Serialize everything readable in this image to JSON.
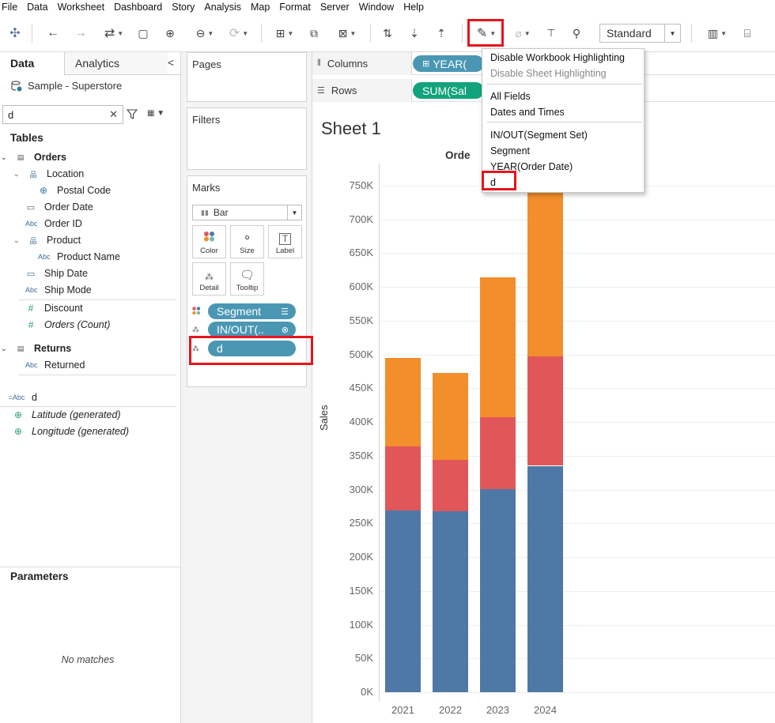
{
  "menu": [
    "File",
    "Data",
    "Worksheet",
    "Dashboard",
    "Story",
    "Analysis",
    "Map",
    "Format",
    "Server",
    "Window",
    "Help"
  ],
  "toolbar": {
    "view_mode": "Standard",
    "icons": [
      "tableau-logo-icon",
      "undo-icon",
      "redo-icon",
      "swap-icon",
      "save-icon",
      "new-datasource-icon",
      "pause-auto-update-icon",
      "refresh-icon",
      "new-worksheet-icon",
      "duplicate-sheet-icon",
      "clear-sheet-icon",
      "swap-rows-columns-icon",
      "sort-ascending-icon",
      "sort-descending-icon",
      "highlight-icon",
      "group-members-icon",
      "show-labels-icon",
      "fix-axes-icon",
      "show-me-icon",
      "presentation-icon"
    ]
  },
  "left_pane": {
    "tabs": [
      "Data",
      "Analytics"
    ],
    "data_source": "Sample - Superstore",
    "search_value": "d",
    "tables_heading": "Tables",
    "fields": [
      {
        "label": "Orders",
        "icon": "table-icon"
      },
      {
        "label": "Location",
        "icon": "hierarchy-icon"
      },
      {
        "label": "Postal Code",
        "icon": "globe-icon"
      },
      {
        "label": "Order Date",
        "icon": "calendar-icon"
      },
      {
        "label": "Order ID",
        "icon": "abc-icon"
      },
      {
        "label": "Product",
        "icon": "hierarchy-icon"
      },
      {
        "label": "Product Name",
        "icon": "abc-icon"
      },
      {
        "label": "Ship Date",
        "icon": "calendar-icon"
      },
      {
        "label": "Ship Mode",
        "icon": "abc-icon"
      },
      {
        "label": "Discount",
        "icon": "number-icon"
      },
      {
        "label": "Orders (Count)",
        "icon": "number-icon"
      },
      {
        "label": "Returns",
        "icon": "table-icon"
      },
      {
        "label": "Returned",
        "icon": "abc-icon"
      },
      {
        "label": "d",
        "icon": "calc-abc-icon"
      },
      {
        "label": "Latitude (generated)",
        "icon": "globe-icon"
      },
      {
        "label": "Longitude (generated)",
        "icon": "globe-icon"
      }
    ],
    "parameters_heading": "Parameters",
    "parameters_empty": "No matches"
  },
  "shelves": {
    "pages": "Pages",
    "filters": "Filters",
    "marks": "Marks",
    "mark_type": "Bar",
    "mark_buttons": [
      "Color",
      "Size",
      "Label",
      "Detail",
      "Tooltip"
    ],
    "mark_pills": [
      "Segment",
      "IN/OUT(..",
      "d"
    ],
    "columns_label": "Columns",
    "columns_pill": "YEAR(",
    "rows_label": "Rows",
    "rows_pill": "SUM(Sal"
  },
  "sheet": {
    "title": "Sheet 1",
    "header": "Orde"
  },
  "highlight_menu": {
    "items": [
      "Disable Workbook Highlighting",
      "Disable Sheet Highlighting",
      "All Fields",
      "Dates and Times",
      "IN/OUT(Segment Set)",
      "Segment",
      "YEAR(Order Date)",
      "d"
    ]
  },
  "chart_data": {
    "type": "bar",
    "stacked": true,
    "categories": [
      "2021",
      "2022",
      "2023",
      "2024"
    ],
    "ylabel": "Sales",
    "ylim": [
      0,
      750000
    ],
    "yticks": [
      "0K",
      "50K",
      "100K",
      "150K",
      "200K",
      "250K",
      "300K",
      "350K",
      "400K",
      "450K",
      "500K",
      "550K",
      "600K",
      "650K",
      "700K",
      "750K"
    ],
    "series": [
      {
        "color": "#4e79a7",
        "values": [
          269000,
          268000,
          301000,
          335000
        ]
      },
      {
        "color": "#e15759",
        "values": [
          95000,
          76000,
          106000,
          162000
        ]
      },
      {
        "color": "#f28e2b",
        "values": [
          131000,
          129000,
          207000,
          253000
        ]
      }
    ]
  }
}
